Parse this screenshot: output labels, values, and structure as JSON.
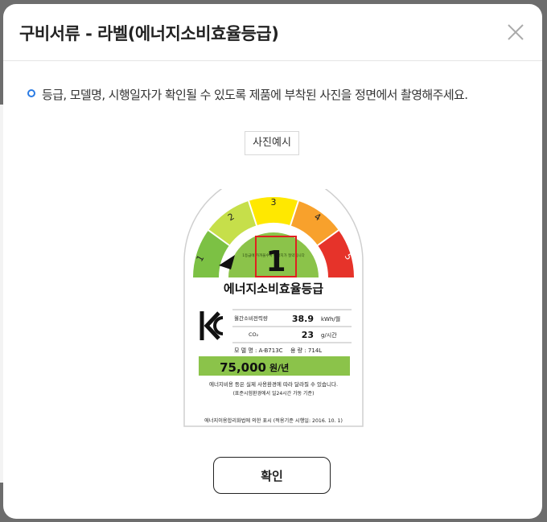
{
  "modal": {
    "title": "구비서류 - 라벨(에너지소비효율등급)",
    "notice": "등급, 모델명, 시행일자가 확인될 수 있도록 제품에 부착된 사진을 정면에서 촬영해주세요.",
    "example_tag": "사진예시",
    "confirm_label": "확인",
    "accent_color": "#2a7be4"
  },
  "label": {
    "grades": [
      "1",
      "2",
      "3",
      "4",
      "5"
    ],
    "current_grade": "1",
    "arc_small_text": "1등급에 가까울수록 에너지가 절약됩니다",
    "heading": "에너지소비효율등급",
    "rows": [
      {
        "name": "월간소비전력량",
        "value": "38.9",
        "unit": "kWh/월"
      },
      {
        "name": "CO₂",
        "value": "23",
        "unit": "g/시간"
      }
    ],
    "model_text": "모 델 명 : A-B713C",
    "capacity_text": "용 량 : 714L",
    "cost": "75,000",
    "cost_unit": "원/년",
    "note1": "에너지비용 등은 실제 사용환경에 따라 달라질 수 있습니다.",
    "note2": "(표준시험환경에서 일24시간 가동 기준)",
    "footer": "에너지이용합리화법에 의한 표시 (적용기준 시행일: 2016. 10. 1)",
    "kc_mark": "KC"
  }
}
